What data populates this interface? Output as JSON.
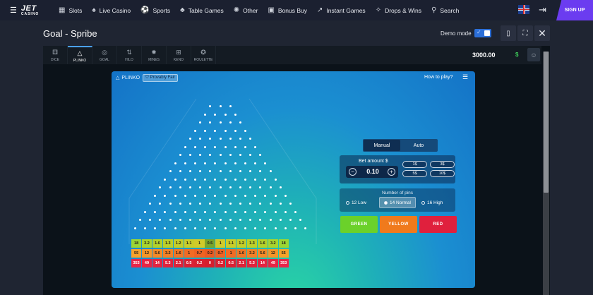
{
  "nav": {
    "brand": "JET",
    "brand_sub": "CASINO",
    "items": [
      {
        "icon": "slots-icon",
        "glyph": "▦",
        "label": "Slots"
      },
      {
        "icon": "live-casino-icon",
        "glyph": "♠",
        "label": "Live Casino"
      },
      {
        "icon": "sports-icon",
        "glyph": "⚽",
        "label": "Sports"
      },
      {
        "icon": "table-games-icon",
        "glyph": "♣",
        "label": "Table Games"
      },
      {
        "icon": "other-icon",
        "glyph": "✺",
        "label": "Other"
      },
      {
        "icon": "bonus-buy-icon",
        "glyph": "▣",
        "label": "Bonus Buy"
      },
      {
        "icon": "instant-games-icon",
        "glyph": "↗",
        "label": "Instant Games"
      },
      {
        "icon": "drops-wins-icon",
        "glyph": "✧",
        "label": "Drops & Wins"
      },
      {
        "icon": "search-icon",
        "glyph": "⚲",
        "label": "Search"
      }
    ],
    "signup": "SIGN UP"
  },
  "header": {
    "title": "Goal - Spribe",
    "demo_label": "Demo mode"
  },
  "game_tabs": [
    {
      "glyph": "⚅",
      "label": "DICE"
    },
    {
      "glyph": "△",
      "label": "PLINKO",
      "active": true
    },
    {
      "glyph": "◎",
      "label": "GOAL"
    },
    {
      "glyph": "⇅",
      "label": "HILO"
    },
    {
      "glyph": "✹",
      "label": "MINES"
    },
    {
      "glyph": "⊞",
      "label": "KENO"
    },
    {
      "glyph": "✪",
      "label": "ROULETTE"
    }
  ],
  "wallet": {
    "balance": "3000.00",
    "currency": "$"
  },
  "plinko": {
    "name": "PLINKO",
    "provably_fair": "Provably Fair",
    "how_to": "How to play?",
    "modes": [
      "Manual",
      "Auto"
    ],
    "active_mode": "Manual",
    "bet_label": "Bet amount $",
    "bet_value": "0.10",
    "chips": [
      "1$",
      "3$",
      "5$",
      "10$"
    ],
    "pins_label": "Number of pins",
    "pin_options": [
      "12 Low",
      "14 Normal",
      "16 High"
    ],
    "selected_pins": "14 Normal",
    "buttons": [
      {
        "label": "GREEN",
        "color": "#6bd12a"
      },
      {
        "label": "YELLOW",
        "color": "#f07a1c"
      },
      {
        "label": "RED",
        "color": "#e0203d"
      }
    ],
    "peg_rows": 16,
    "multipliers": {
      "green": [
        "18",
        "3.2",
        "1.6",
        "1.3",
        "1.2",
        "1.1",
        "1",
        "0.5",
        "1",
        "1.1",
        "1.2",
        "1.3",
        "1.6",
        "3.2",
        "18"
      ],
      "yellow": [
        "55",
        "12",
        "5.6",
        "3.2",
        "1.6",
        "1",
        "0.7",
        "0.2",
        "0.7",
        "1",
        "1.6",
        "3.2",
        "5.6",
        "12",
        "55"
      ],
      "red": [
        "353",
        "49",
        "14",
        "5.3",
        "2.1",
        "0.5",
        "0.2",
        "0",
        "0.2",
        "0.5",
        "2.1",
        "5.3",
        "14",
        "49",
        "353"
      ]
    },
    "colors": {
      "green_cells": [
        "#9bd634",
        "#a8d42e",
        "#b3d12a",
        "#bcd02a",
        "#c4cf29",
        "#c9cd29",
        "#d0cb2a",
        "#7aa52a"
      ],
      "yellow_cells": [
        "#f6a32a",
        "#f59628",
        "#f48a27",
        "#f38026",
        "#f27625",
        "#f16b24",
        "#ef6223",
        "#ec5a22"
      ],
      "red_cells": [
        "#e8264a",
        "#e52545",
        "#e32441",
        "#e0233d",
        "#dd2239",
        "#da2135",
        "#d72031",
        "#d41f2d"
      ]
    }
  }
}
